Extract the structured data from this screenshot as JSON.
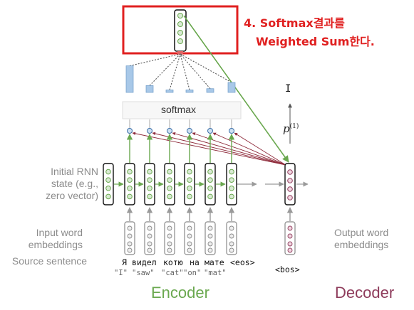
{
  "annotation": {
    "line1": "4. Softmax결과를",
    "line2": "Weighted Sum한다.",
    "color": "#e02020"
  },
  "softmax_label": "softmax",
  "left_labels": {
    "initial_state": [
      "Initial RNN",
      "state (e.g.,",
      "zero vector)"
    ],
    "input_embeddings": [
      "Input word",
      "embeddings"
    ],
    "source_sentence": "Source sentence"
  },
  "right_labels": {
    "output_embeddings": [
      "Output word",
      "embeddings"
    ]
  },
  "source_tokens": [
    "Я",
    "видел",
    "котю",
    "на",
    "мате",
    "<eos>"
  ],
  "translations": [
    "\"I\"",
    "\"saw\"",
    "\"cat\"",
    "\"on\"",
    "\"mat\""
  ],
  "decoder_input": "<bos>",
  "decoder_output": "I",
  "prob_label": "p",
  "prob_superscript": "(1)",
  "section_labels": {
    "encoder": "Encoder",
    "decoder": "Decoder"
  },
  "attention_weights": [
    0.85,
    0.22,
    0.08,
    0.08,
    0.12,
    0.32
  ],
  "colors": {
    "encoder": "#6aa84f",
    "decoder": "#8e3b5b",
    "attention_bar": "#a8c8e8",
    "score_dot": "#cfe2f3",
    "highlight_box": "#e02020"
  }
}
